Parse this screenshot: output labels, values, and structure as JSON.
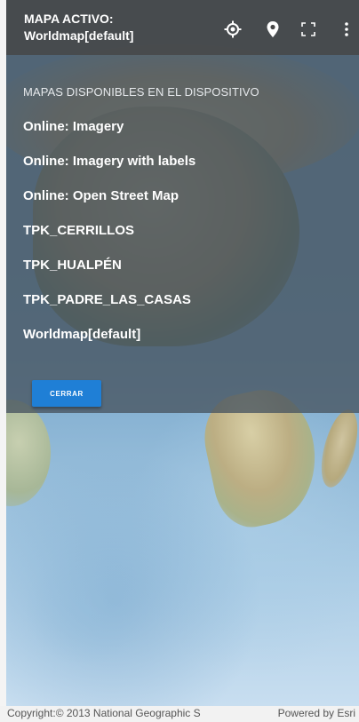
{
  "header": {
    "title_line1": "MAPA ACTIVO:",
    "title_line2": "Worldmap[default]",
    "icons": [
      "crosshair-icon",
      "location-pin-icon",
      "fullscreen-icon",
      "more-vertical-icon"
    ]
  },
  "panel": {
    "heading": "MAPAS DISPONIBLES EN EL DISPOSITIVO",
    "items": [
      {
        "label": "Online: Imagery"
      },
      {
        "label": "Online: Imagery with labels"
      },
      {
        "label": "Online: Open Street Map"
      },
      {
        "label": "TPK_CERRILLOS"
      },
      {
        "label": "TPK_HUALPÉN"
      },
      {
        "label": "TPK_PADRE_LAS_CASAS"
      },
      {
        "label": "Worldmap[default]"
      }
    ],
    "close_label": "CERRAR"
  },
  "footer": {
    "copyright": "Copyright:© 2013 National Geographic S",
    "powered_by": "Powered by Esri"
  },
  "colors": {
    "accent": "#1f7fd6",
    "overlay": "#485460",
    "topbar": "#464646"
  }
}
